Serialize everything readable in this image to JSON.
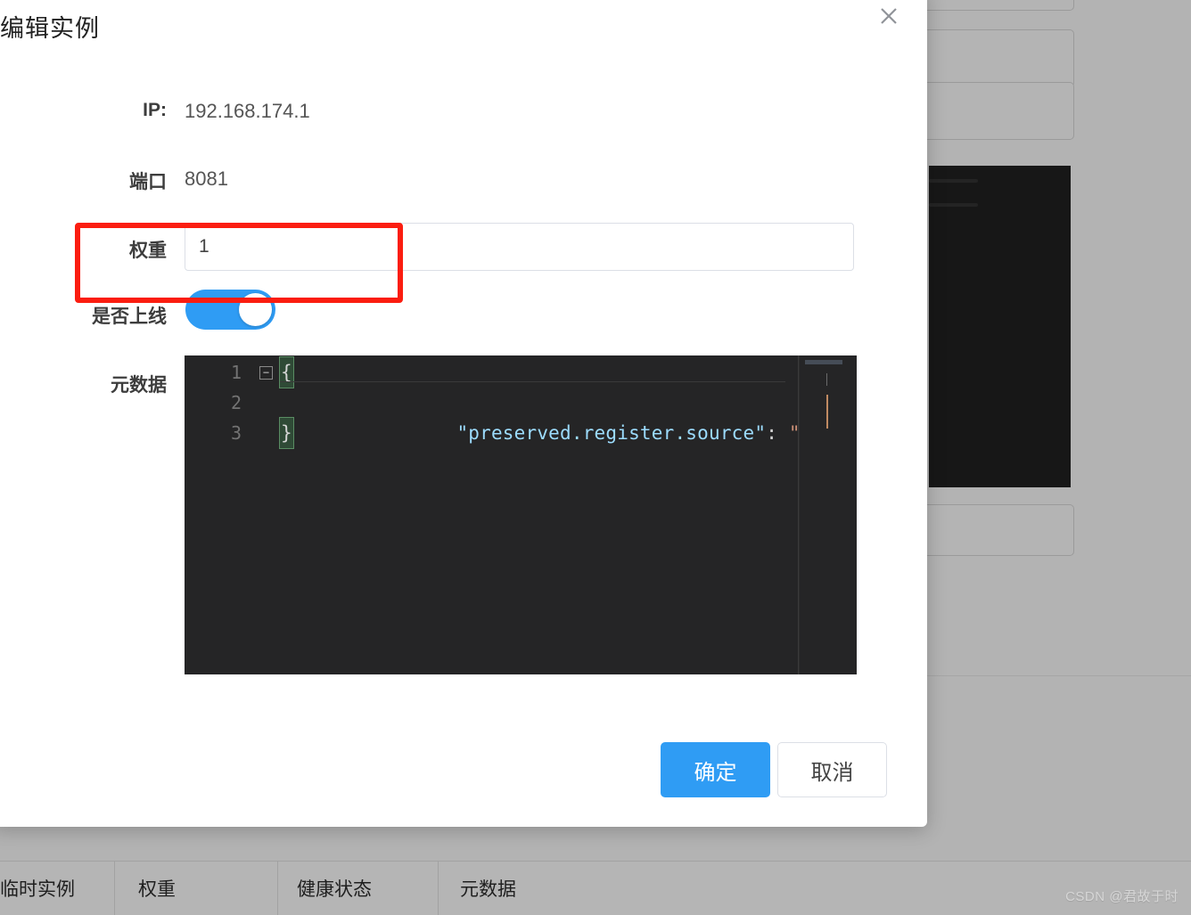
{
  "background": {
    "table_headers": [
      "临时实例",
      "权重",
      "健康状态",
      "元数据"
    ],
    "watermark": "CSDN @君故于时",
    "overlay_color": "#b3b3b3",
    "panel_color": "#b4b4b4",
    "editor_color": "#171717"
  },
  "modal": {
    "title": "编辑实例",
    "close_icon": "close-icon",
    "fields": {
      "ip_label": "IP:",
      "ip_value": "192.168.174.1",
      "port_label": "端口",
      "port_value": "8081",
      "weight_label": "权重",
      "weight_value": "1",
      "weight_placeholder": "",
      "online_label": "是否上线",
      "online_state": "on",
      "metadata_label": "元数据"
    },
    "editor": {
      "language": "json",
      "line_numbers": [
        "1",
        "2",
        "3"
      ],
      "fold_icon": "−",
      "lines": [
        {
          "num": "1",
          "open_brace": "{"
        },
        {
          "num": "2",
          "key": "\"preserved.register.source\"",
          "colon": ":",
          "value": "\"SPRING_C"
        },
        {
          "num": "3",
          "close_brace": "}"
        }
      ],
      "colors": {
        "background": "#252526",
        "key": "#9cdcfe",
        "value": "#ce9178",
        "line_number": "#737373",
        "bracket_match": "#2f4a36"
      }
    },
    "buttons": {
      "confirm": "确定",
      "cancel": "取消",
      "primary_color": "#2f9cf4"
    }
  },
  "annotation": {
    "shape": "rectangle",
    "color": "#fb1d10",
    "target": "权重"
  }
}
